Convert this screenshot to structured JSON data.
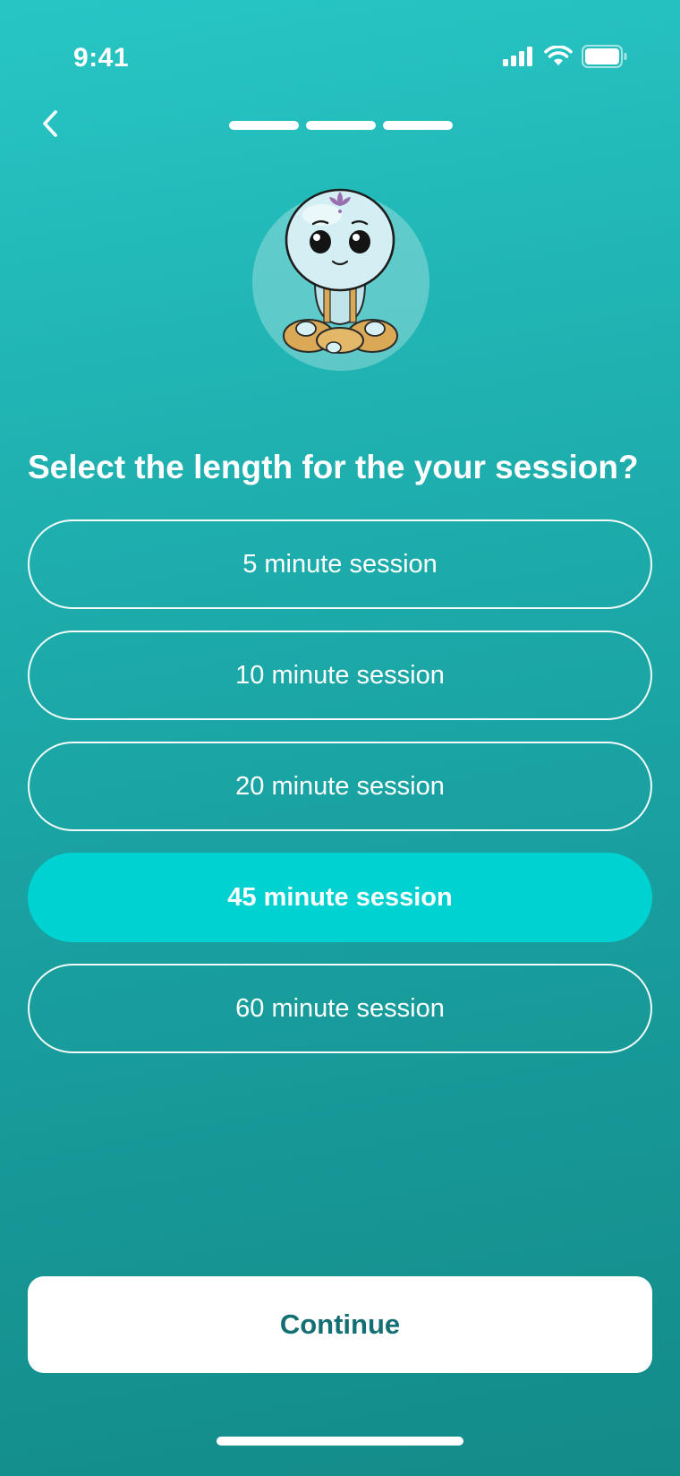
{
  "status_bar": {
    "time": "9:41",
    "icons": [
      "cellular-signal-icon",
      "wifi-icon",
      "battery-icon"
    ]
  },
  "header": {
    "back_icon": "chevron-left-icon",
    "progress_steps_total": 3,
    "progress_steps_completed": 3
  },
  "mascot": {
    "icon": "meditating-mascot-icon"
  },
  "question": "Select the length for the your session?",
  "options": [
    {
      "label": "5 minute session",
      "selected": false
    },
    {
      "label": "10 minute session",
      "selected": false
    },
    {
      "label": "20 minute session",
      "selected": false
    },
    {
      "label": "45 minute session",
      "selected": true
    },
    {
      "label": "60 minute session",
      "selected": false
    }
  ],
  "continue_label": "Continue",
  "colors": {
    "background_top": "#27c6c5",
    "background_bottom": "#138b89",
    "selected_option": "#00d1d1",
    "continue_text": "#136f74",
    "white": "#ffffff"
  }
}
